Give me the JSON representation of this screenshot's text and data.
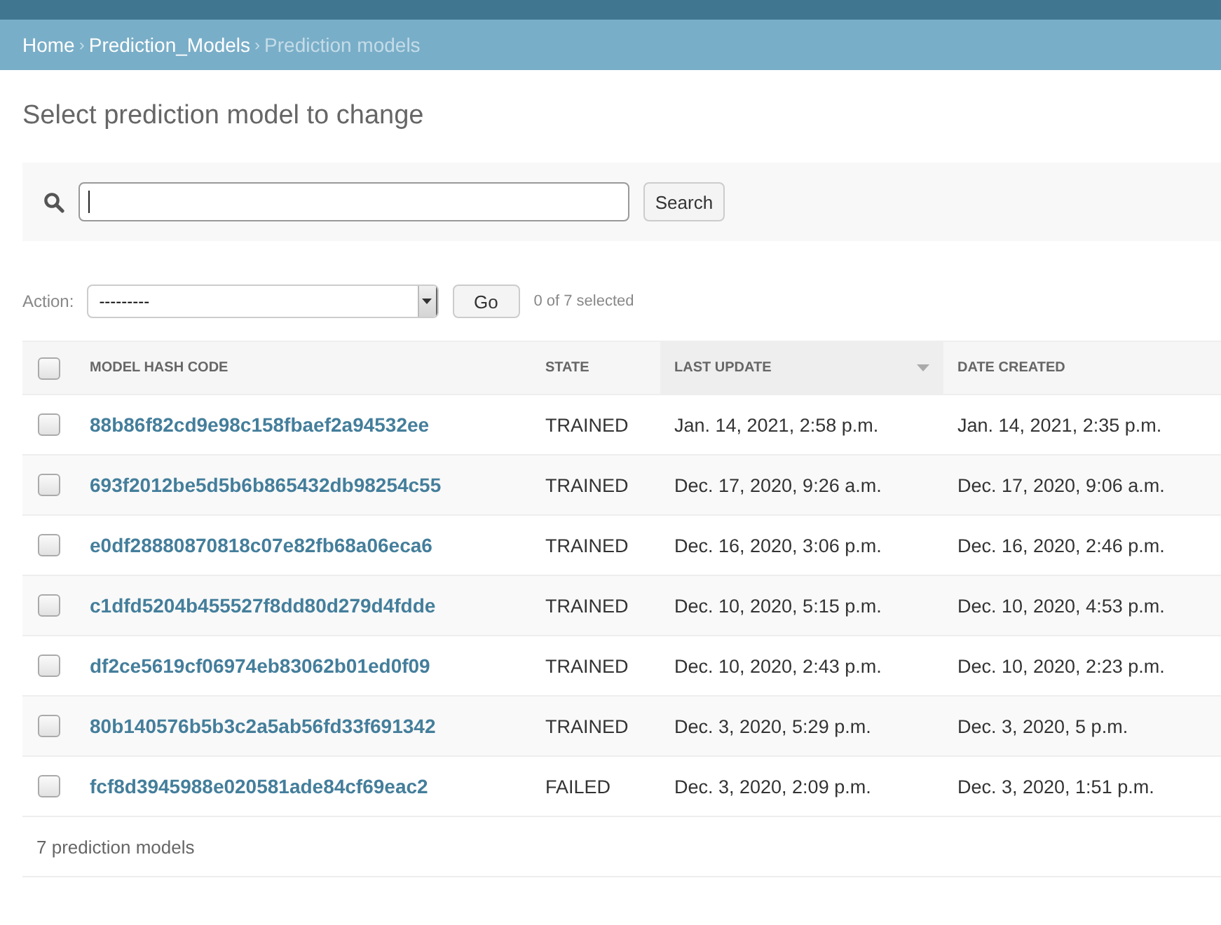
{
  "breadcrumbs": {
    "separator": "›",
    "items": [
      {
        "label": "Home",
        "current": false
      },
      {
        "label": "Prediction_Models",
        "current": false
      },
      {
        "label": "Prediction models",
        "current": true
      }
    ]
  },
  "title": "Select prediction model to change",
  "search": {
    "focused": true,
    "button": "Search"
  },
  "actions": {
    "label": "Action:",
    "select_value": "---------",
    "button": "Go",
    "selection_count": "0 of 7 selected"
  },
  "table": {
    "select_all": {
      "checked": false
    },
    "columns": [
      {
        "label": "MODEL HASH CODE",
        "kind": "link",
        "sorted": false
      },
      {
        "label": "STATE",
        "kind": "text",
        "sorted": false
      },
      {
        "label": "LAST UPDATE",
        "kind": "text",
        "sorted": true
      },
      {
        "label": "DATE CREATED",
        "kind": "text",
        "sorted": false
      }
    ],
    "rows": [
      {
        "checked": false,
        "cells": [
          "88b86f82cd9e98c158fbaef2a94532ee",
          "TRAINED",
          "Jan. 14, 2021, 2:58 p.m.",
          "Jan. 14, 2021, 2:35 p.m."
        ]
      },
      {
        "checked": false,
        "cells": [
          "693f2012be5d5b6b865432db98254c55",
          "TRAINED",
          "Dec. 17, 2020, 9:26 a.m.",
          "Dec. 17, 2020, 9:06 a.m."
        ]
      },
      {
        "checked": false,
        "cells": [
          "e0df28880870818c07e82fb68a06eca6",
          "TRAINED",
          "Dec. 16, 2020, 3:06 p.m.",
          "Dec. 16, 2020, 2:46 p.m."
        ]
      },
      {
        "checked": false,
        "cells": [
          "c1dfd5204b455527f8dd80d279d4fdde",
          "TRAINED",
          "Dec. 10, 2020, 5:15 p.m.",
          "Dec. 10, 2020, 4:53 p.m."
        ]
      },
      {
        "checked": false,
        "cells": [
          "df2ce5619cf06974eb83062b01ed0f09",
          "TRAINED",
          "Dec. 10, 2020, 2:43 p.m.",
          "Dec. 10, 2020, 2:23 p.m."
        ]
      },
      {
        "checked": false,
        "cells": [
          "80b140576b5b3c2a5ab56fd33f691342",
          "TRAINED",
          "Dec. 3, 2020, 5:29 p.m.",
          "Dec. 3, 2020, 5 p.m."
        ]
      },
      {
        "checked": false,
        "cells": [
          "fcf8d3945988e020581ade84cf69eac2",
          "FAILED",
          "Dec. 3, 2020, 2:09 p.m.",
          "Dec. 3, 2020, 1:51 p.m."
        ]
      }
    ]
  },
  "footer": "7 prediction models"
}
